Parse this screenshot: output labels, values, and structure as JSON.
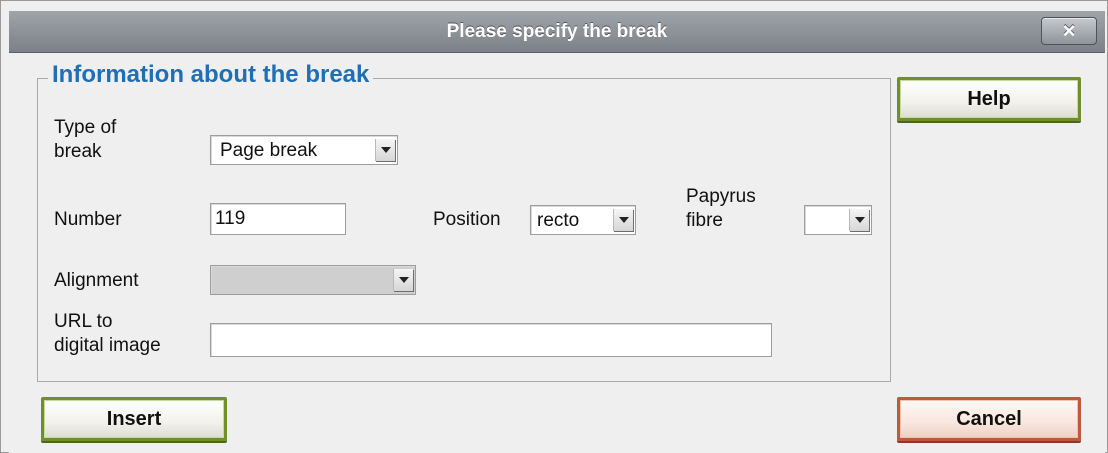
{
  "dialog": {
    "title": "Please specify the break",
    "close_label": "×"
  },
  "group": {
    "legend": "Information about the break"
  },
  "fields": {
    "type_label_line1": "Type of",
    "type_label_line2": "break",
    "type_value": "Page break",
    "number_label": "Number",
    "number_value": "119",
    "position_label": "Position",
    "position_value": "recto",
    "fibre_label_line1": "Papyrus",
    "fibre_label_line2": "fibre",
    "fibre_value": "",
    "alignment_label": "Alignment",
    "alignment_value": "",
    "url_label_line1": "URL to",
    "url_label_line2": "digital image",
    "url_value": ""
  },
  "buttons": {
    "help": "Help",
    "insert": "Insert",
    "cancel": "Cancel"
  },
  "colors": {
    "legend": "#1f6fb5",
    "green_button_border": "#6f8f2c",
    "cancel_button_border": "#c0583e"
  }
}
